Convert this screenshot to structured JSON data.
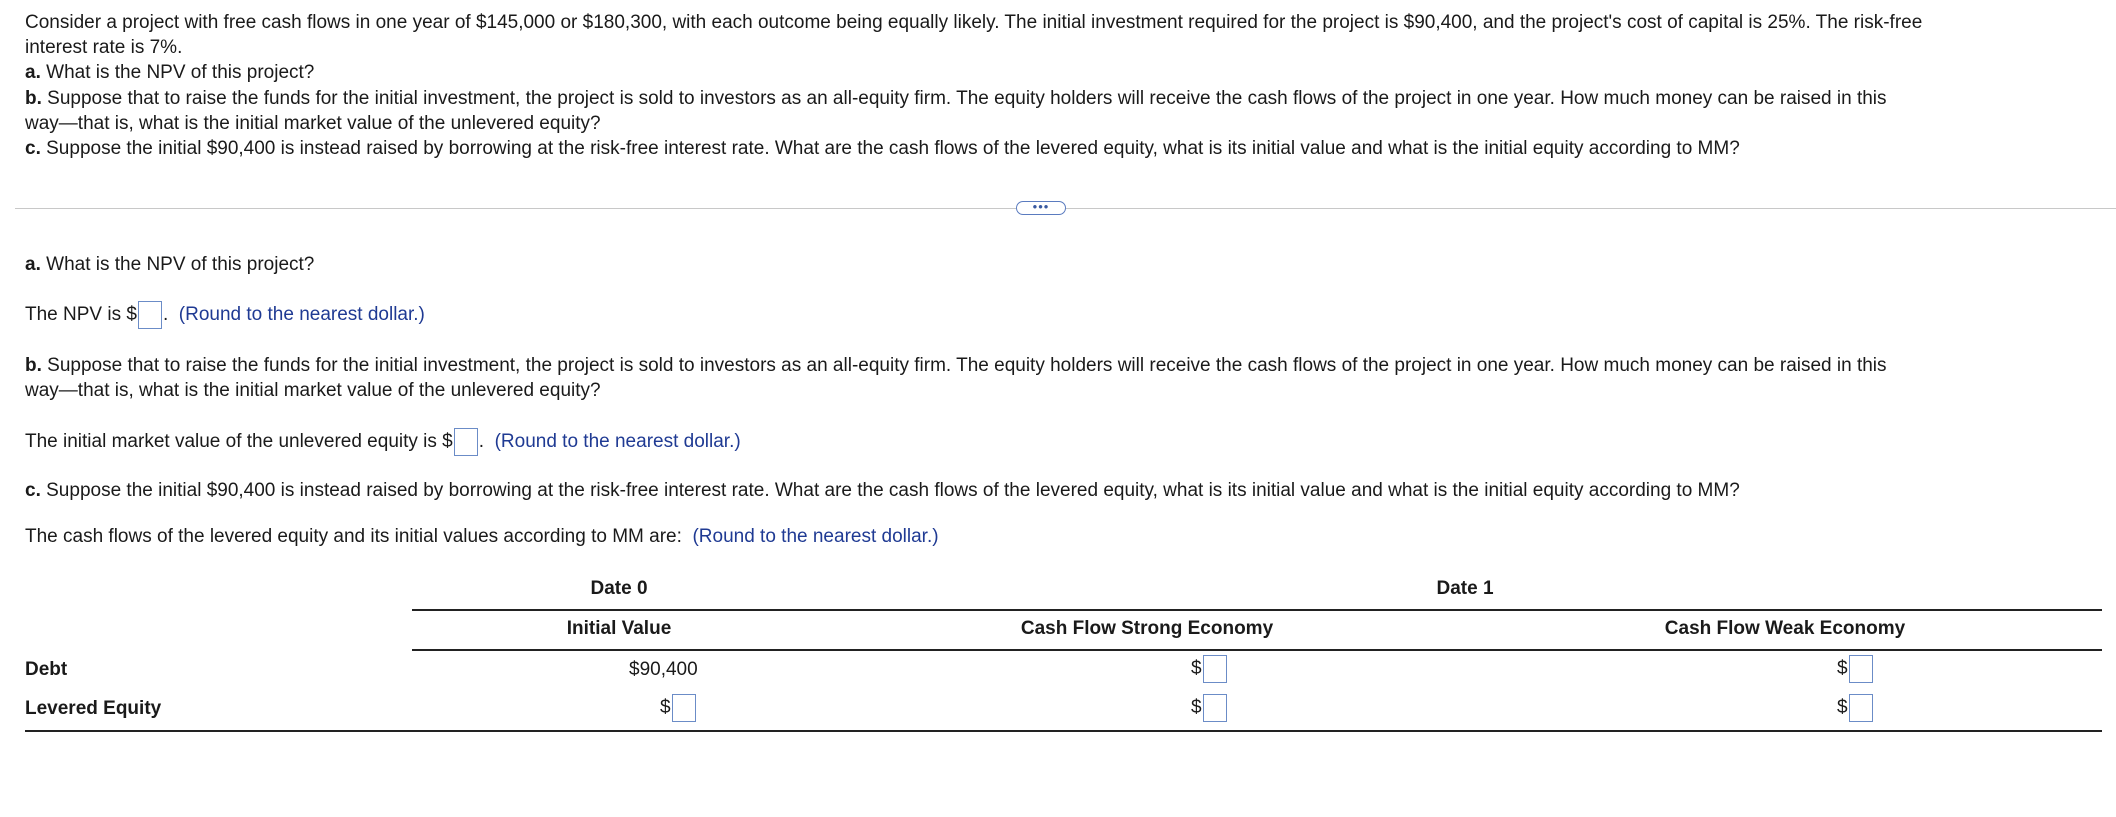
{
  "problem": {
    "line1": "Consider a project with free cash flows in one year of $145,000 or $180,300, with each outcome being equally likely. The initial investment required for the project is $90,400, and the project's cost of capital is 25%. The risk-free",
    "line2": "interest rate is 7%.",
    "a_label": "a.",
    "a_text": " What is the NPV of this project?",
    "b_label": "b.",
    "b_text1": " Suppose that to raise the funds for the initial investment, the project is sold to investors as an all-equity firm. The equity holders will receive the cash flows of the project in one year. How much money can be raised in this",
    "b_text2": "way—that is, what is the initial market value of the unlevered equity?",
    "c_label": "c.",
    "c_text": " Suppose the initial $90,400 is instead raised by borrowing at the risk-free interest rate. What are the cash flows of the levered equity, what is its initial value and what is the initial equity according to MM?"
  },
  "more_button": "•••",
  "part_a": {
    "label": "a.",
    "question": " What is the NPV of this project?",
    "answer_prefix": "The NPV is $",
    "answer_suffix": ".",
    "hint": "(Round to the nearest dollar.)"
  },
  "part_b": {
    "label": "b.",
    "question1": " Suppose that to raise the funds for the initial investment, the project is sold to investors as an all-equity firm. The equity holders will receive the cash flows of the project in one year. How much money can be raised in this",
    "question2": "way—that is, what is the initial market value of the unlevered equity?",
    "answer_prefix": "The initial market value of the unlevered equity is $",
    "answer_suffix": ".",
    "hint": "(Round to the nearest dollar.)"
  },
  "part_c": {
    "label": "c.",
    "question": " Suppose the initial $90,400 is instead raised by borrowing at the risk-free interest rate. What are the cash flows of the levered equity, what is its initial value and what is the initial equity according to MM?",
    "intro": "The cash flows of the levered equity and its initial values according to MM are:",
    "hint": "(Round to the nearest dollar.)"
  },
  "table": {
    "date0": "Date 0",
    "date1": "Date 1",
    "col_initial": "Initial Value",
    "col_strong": "Cash Flow Strong Economy",
    "col_weak": "Cash Flow Weak Economy",
    "rows": [
      {
        "label": "Debt",
        "initial": "$90,400",
        "strong_prefix": "$",
        "weak_prefix": "$"
      },
      {
        "label": "Levered Equity",
        "initial_prefix": "$",
        "strong_prefix": "$",
        "weak_prefix": "$"
      }
    ]
  }
}
